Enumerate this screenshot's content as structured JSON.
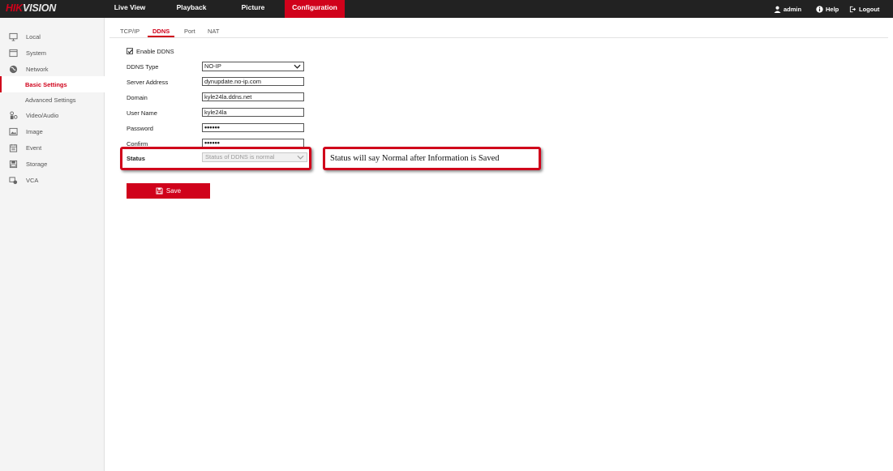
{
  "brand": {
    "prefix": "HIK",
    "suffix": "VISION"
  },
  "topnav": [
    {
      "label": "Live View",
      "active": false
    },
    {
      "label": "Playback",
      "active": false
    },
    {
      "label": "Picture",
      "active": false
    },
    {
      "label": "Configuration",
      "active": true
    }
  ],
  "topright": {
    "user": "admin",
    "help": "Help",
    "logout": "Logout"
  },
  "sidebar": {
    "items": [
      {
        "label": "Local",
        "icon": "monitor-icon"
      },
      {
        "label": "System",
        "icon": "system-icon"
      },
      {
        "label": "Network",
        "icon": "globe-icon"
      },
      {
        "label": "Basic Settings",
        "selected": true
      },
      {
        "label": "Advanced Settings"
      },
      {
        "label": "Video/Audio",
        "icon": "video-audio-icon"
      },
      {
        "label": "Image",
        "icon": "image-icon"
      },
      {
        "label": "Event",
        "icon": "event-icon"
      },
      {
        "label": "Storage",
        "icon": "storage-icon"
      },
      {
        "label": "VCA",
        "icon": "vca-icon"
      }
    ]
  },
  "tabs": [
    {
      "label": "TCP/IP",
      "active": false
    },
    {
      "label": "DDNS",
      "active": true
    },
    {
      "label": "Port",
      "active": false
    },
    {
      "label": "NAT",
      "active": false
    }
  ],
  "form": {
    "enable_ddns": {
      "label": "Enable DDNS",
      "checked": true
    },
    "ddns_type": {
      "label": "DDNS Type",
      "value": "NO-IP"
    },
    "server_address": {
      "label": "Server Address",
      "value": "dynupdate.no-ip.com"
    },
    "domain": {
      "label": "Domain",
      "value": "kyle24la.ddns.net"
    },
    "user_name": {
      "label": "User Name",
      "value": "kyle24la"
    },
    "password": {
      "label": "Password",
      "value": "••••••"
    },
    "confirm": {
      "label": "Confirm",
      "value": "••••••"
    },
    "status": {
      "label": "Status",
      "value": "Status of DDNS is normal"
    }
  },
  "annotation": "Status will say Normal after Information is Saved",
  "save_label": "Save",
  "colors": {
    "accent": "#d0021b",
    "topbar": "#222222",
    "sidebar": "#f4f4f4"
  }
}
